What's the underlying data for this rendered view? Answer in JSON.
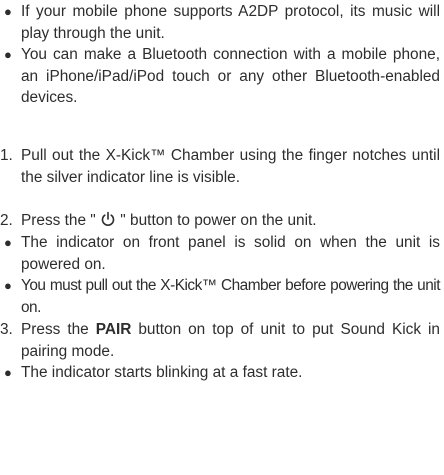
{
  "bullets_top": [
    "If your mobile phone supports A2DP protocol, its music will play through the unit.",
    "You can make a Bluetooth connection with a mobile phone, an  iPhone/iPad/iPod touch or any other Bluetooth-enabled devices."
  ],
  "steps": {
    "s1": {
      "num": "1.",
      "text": "Pull out the X-Kick™ Chamber using the finger notches until the silver indicator line is visible."
    },
    "s2": {
      "num": "2.",
      "before": "Press the \" ",
      "after": " \" button to power on the unit."
    },
    "s2_bullets": [
      "The indicator on front panel is solid on when the unit is powered on.",
      "You must pull out the X-Kick™ Chamber before powering the unit on."
    ],
    "s3": {
      "num": "3.",
      "before": "Press the ",
      "bold": "PAIR",
      "after": " button on top of unit to put Sound Kick in pairing mode."
    },
    "s3_bullets": [
      "The indicator starts blinking at a fast rate."
    ]
  },
  "icons": {
    "bullet": "●",
    "power": "power-icon"
  }
}
